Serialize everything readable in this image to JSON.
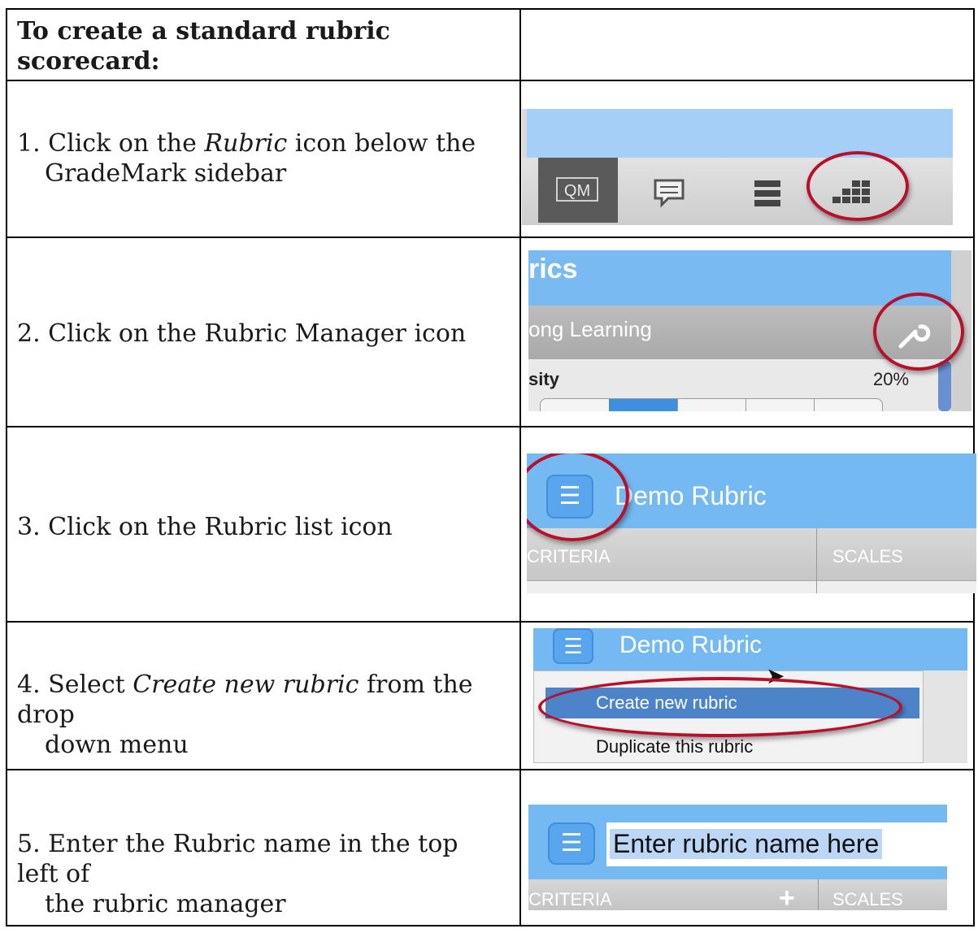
{
  "header": {
    "title": "To create a standard rubric scorecard:"
  },
  "steps": [
    {
      "line1_a": "1. Click on the ",
      "line1_em": "Rubric",
      "line1_b": " icon below the",
      "line2": "GradeMark sidebar"
    },
    {
      "text": "2. Click on the Rubric Manager icon"
    },
    {
      "text": "3. Click on the Rubric list icon"
    },
    {
      "line1_a": "4. Select ",
      "line1_em": "Create new rubric",
      "line1_b": " from the drop",
      "line2": "down menu"
    },
    {
      "line1": "5. Enter the Rubric name in the top left of",
      "line2": "the rubric manager"
    }
  ],
  "shot1": {
    "qm_label": "QM",
    "icons": [
      "comment-icon",
      "list-icon",
      "rubric-grid-icon"
    ]
  },
  "shot2": {
    "title_fragment": "rics",
    "row_fragment": "ong Learning",
    "label_fragment": "sity",
    "percent": "20%",
    "icon": "wrench-icon"
  },
  "shot3": {
    "rubric_title": "Demo Rubric",
    "col_criteria": "CRITERIA",
    "col_scales": "SCALES",
    "icon": "list-menu-icon"
  },
  "shot4": {
    "rubric_title": "Demo Rubric",
    "menu_items": [
      "Create new rubric",
      "Duplicate this rubric"
    ],
    "icon": "list-menu-icon"
  },
  "shot5": {
    "input_value": "Enter rubric name here",
    "col_criteria": "CRITERIA",
    "col_scales": "SCALES",
    "icon": "list-menu-icon"
  },
  "colors": {
    "highlight_ring": "#b8102a",
    "header_blue": "#74b9f2"
  }
}
